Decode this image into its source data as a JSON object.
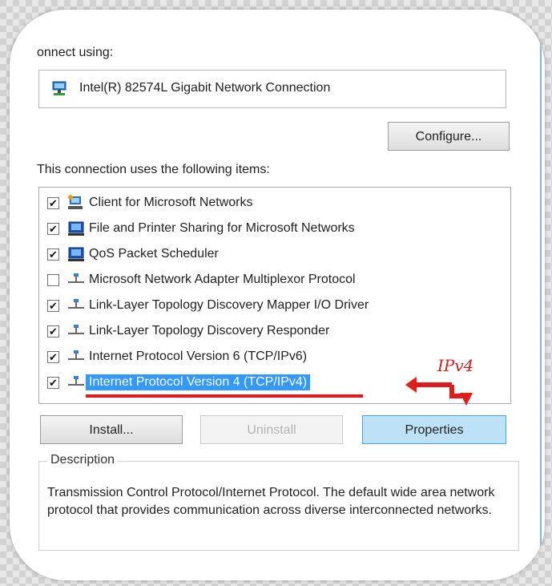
{
  "connect_using_label": "onnect using:",
  "adapter": {
    "name": "Intel(R) 82574L Gigabit Network Connection",
    "icon": "network-adapter-icon"
  },
  "buttons": {
    "configure": "Configure...",
    "install": "Install...",
    "uninstall": "Uninstall",
    "properties": "Properties"
  },
  "items_label": "This connection uses the following items:",
  "items": [
    {
      "label": "Client for Microsoft Networks",
      "checked": true,
      "icon": "network-client-icon"
    },
    {
      "label": "File and Printer Sharing for Microsoft Networks",
      "checked": true,
      "icon": "network-service-icon"
    },
    {
      "label": "QoS Packet Scheduler",
      "checked": true,
      "icon": "network-service-icon"
    },
    {
      "label": "Microsoft Network Adapter Multiplexor Protocol",
      "checked": false,
      "icon": "protocol-icon"
    },
    {
      "label": "Link-Layer Topology Discovery Mapper I/O Driver",
      "checked": true,
      "icon": "protocol-icon"
    },
    {
      "label": "Link-Layer Topology Discovery Responder",
      "checked": true,
      "icon": "protocol-icon"
    },
    {
      "label": "Internet Protocol Version 6 (TCP/IPv6)",
      "checked": true,
      "icon": "protocol-icon"
    },
    {
      "label": "Internet Protocol Version 4 (TCP/IPv4)",
      "checked": true,
      "icon": "protocol-icon",
      "selected": true
    }
  ],
  "annotation": {
    "text": "IPv4",
    "color": "#d42020"
  },
  "description": {
    "title": "Description",
    "text": "Transmission Control Protocol/Internet Protocol. The default wide area network protocol that provides communication across diverse interconnected networks."
  },
  "colors": {
    "selection": "#3399ff",
    "highlight_button": "#bde2f7",
    "annotation_red": "#e21c1c"
  }
}
